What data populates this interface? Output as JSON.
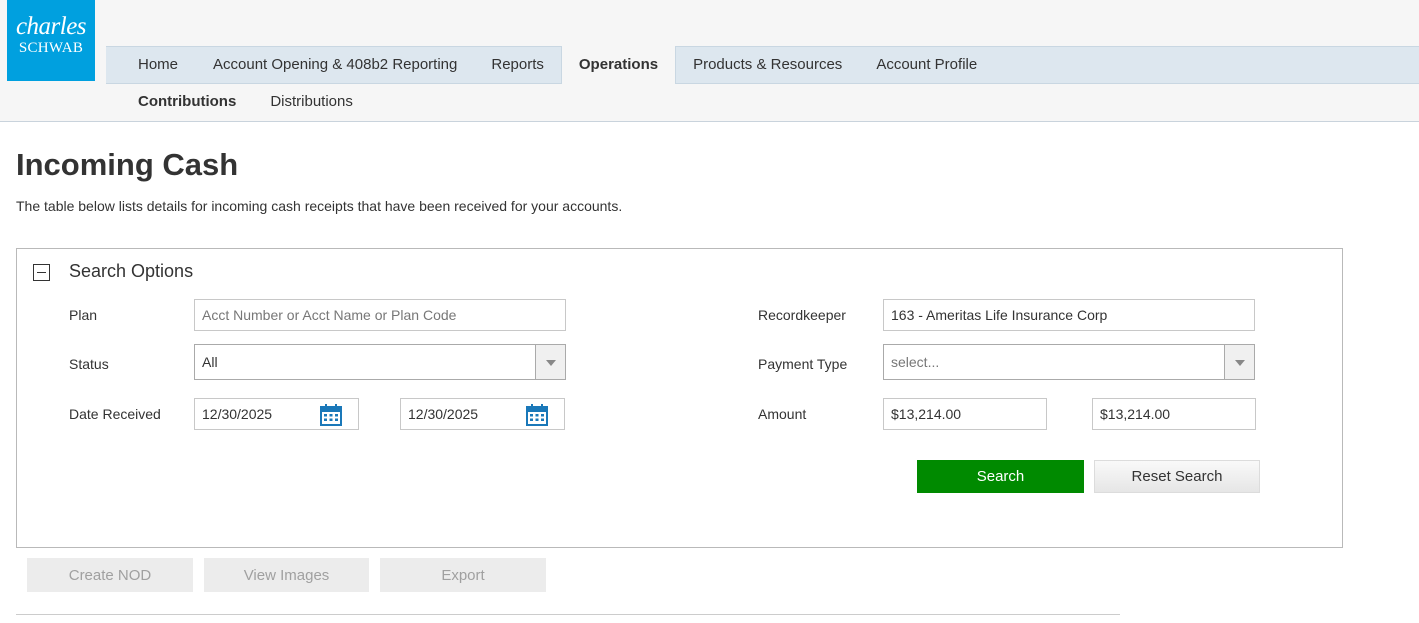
{
  "brand": {
    "line1": "charles",
    "line2": "SCHWAB",
    "color": "#00a0df"
  },
  "main_nav": [
    {
      "label": "Home",
      "active": false
    },
    {
      "label": "Account Opening & 408b2 Reporting",
      "active": false
    },
    {
      "label": "Reports",
      "active": false
    },
    {
      "label": "Operations",
      "active": true
    },
    {
      "label": "Products & Resources",
      "active": false
    },
    {
      "label": "Account Profile",
      "active": false
    }
  ],
  "sub_nav": [
    {
      "label": "Contributions",
      "active": true
    },
    {
      "label": "Distributions",
      "active": false
    }
  ],
  "page": {
    "title": "Incoming Cash",
    "description": "The table below lists details for incoming cash receipts that have been received for your accounts."
  },
  "search_options": {
    "title": "Search Options",
    "plan": {
      "label": "Plan",
      "placeholder": "Acct Number or Acct Name or Plan Code",
      "value": ""
    },
    "status": {
      "label": "Status",
      "value": "All"
    },
    "date_received": {
      "label": "Date Received",
      "from": "12/30/2025",
      "to": "12/30/2025"
    },
    "recordkeeper": {
      "label": "Recordkeeper",
      "value": "163 - Ameritas Life Insurance Corp"
    },
    "payment_type": {
      "label": "Payment Type",
      "placeholder": "select..."
    },
    "amount": {
      "label": "Amount",
      "from": "$13,214.00",
      "to": "$13,214.00"
    },
    "search_label": "Search",
    "reset_label": "Reset Search"
  },
  "actions": {
    "create_nod": "Create NOD",
    "view_images": "View Images",
    "export": "Export"
  },
  "colors": {
    "search_button": "#008a00",
    "nav_bg": "#dde7ef",
    "calendar_icon": "#1a78b9"
  }
}
